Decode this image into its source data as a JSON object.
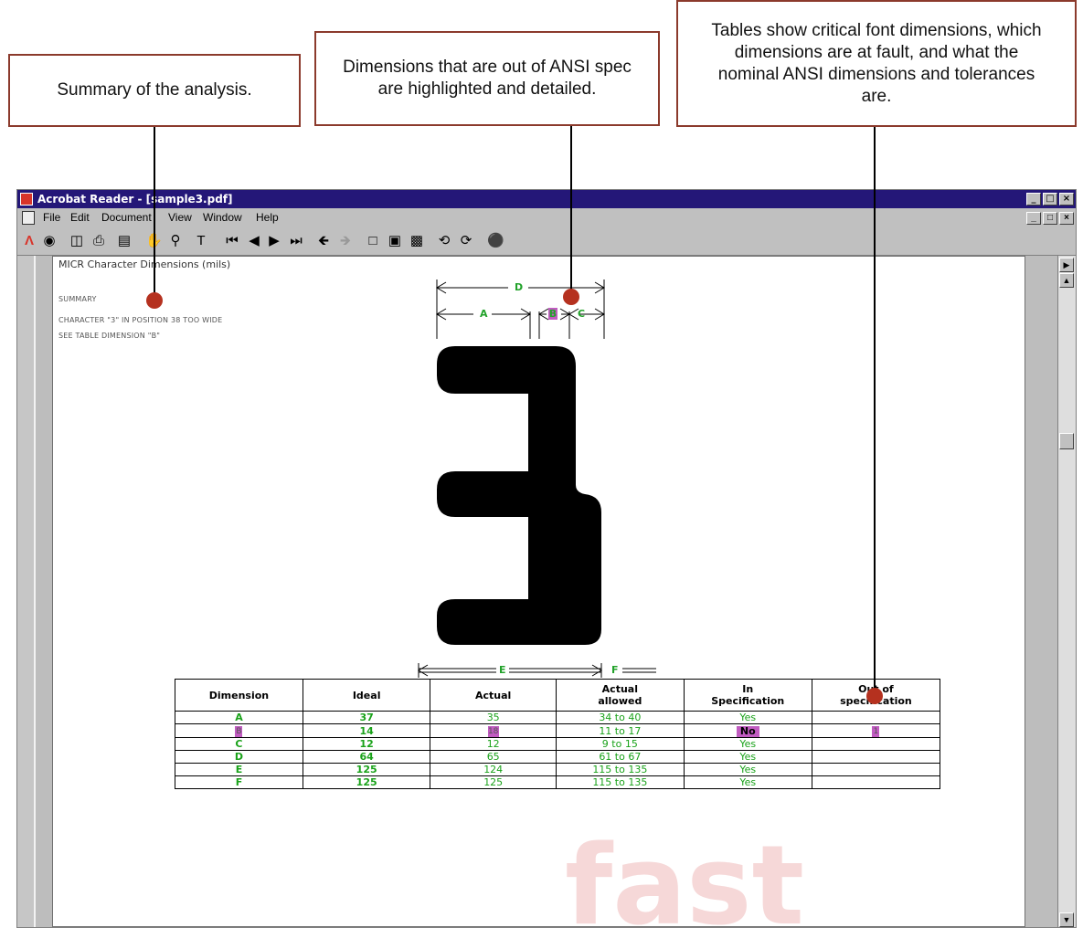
{
  "callouts": {
    "summary": "Summary of the analysis.",
    "dimensions": "Dimensions that are out of ANSI spec are highlighted and detailed.",
    "tables": "Tables show critical font dimensions, which dimensions are at fault, and what the nominal ANSI dimensions and tolerances are."
  },
  "window": {
    "title": "Acrobat Reader - [sample3.pdf]",
    "controls": [
      "_",
      "ɑ",
      "×"
    ]
  },
  "menu": {
    "items": [
      "File",
      "Edit",
      "Document",
      "View",
      "Window",
      "Help"
    ]
  },
  "toolbar": {
    "buttons": [
      "acrobat-logo-icon",
      "web-icon",
      "open-icon",
      "print-icon",
      "thumbnails-icon",
      "hand-tool-icon",
      "zoom-tool-icon",
      "text-select-icon",
      "first-page-icon",
      "previous-page-icon",
      "next-page-icon",
      "last-page-icon",
      "go-back-icon",
      "go-forward-icon",
      "actual-size-icon",
      "fit-page-icon",
      "fit-width-icon",
      "rotate-left-icon",
      "rotate-right-icon",
      "find-icon"
    ]
  },
  "page": {
    "heading": "MICR Character Dimensions (mils)",
    "summary_label": "SUMMARY",
    "summary_line1": "CHARACTER \"3\" IN POSITION 38 TOO WIDE",
    "summary_line2": "SEE TABLE DIMENSION \"B\"",
    "dim_labels": {
      "D": "D",
      "A": "A",
      "B": "B",
      "C": "C",
      "E": "E",
      "F": "F"
    },
    "watermark": "fast"
  },
  "table": {
    "headers": [
      "Dimension",
      "Ideal",
      "Actual",
      "Actual allowed",
      "In Specification",
      "Out of specification"
    ],
    "header_lines": [
      [
        "Dimension"
      ],
      [
        "Ideal"
      ],
      [
        "Actual"
      ],
      [
        "Actual",
        "allowed"
      ],
      [
        "In",
        "Specification"
      ],
      [
        "Out of",
        "specification"
      ]
    ],
    "rows": [
      {
        "dimension": "A",
        "ideal": "37",
        "actual": "35",
        "allowed": "34 to 40",
        "in_spec": "Yes",
        "out_spec": "",
        "highlight": false
      },
      {
        "dimension": "B",
        "ideal": "14",
        "actual": "18",
        "allowed": "11 to 17",
        "in_spec": "No",
        "out_spec": "1",
        "highlight": true
      },
      {
        "dimension": "C",
        "ideal": "12",
        "actual": "12",
        "allowed": "9 to 15",
        "in_spec": "Yes",
        "out_spec": "",
        "highlight": false
      },
      {
        "dimension": "D",
        "ideal": "64",
        "actual": "65",
        "allowed": "61 to 67",
        "in_spec": "Yes",
        "out_spec": "",
        "highlight": false
      },
      {
        "dimension": "E",
        "ideal": "125",
        "actual": "124",
        "allowed": "115 to 135",
        "in_spec": "Yes",
        "out_spec": "",
        "highlight": false
      },
      {
        "dimension": "F",
        "ideal": "125",
        "actual": "125",
        "allowed": "115 to 135",
        "in_spec": "Yes",
        "out_spec": "",
        "highlight": false
      }
    ]
  },
  "colors": {
    "title_bar": "#241778",
    "callout_border": "#8b3a2c",
    "dot": "#b5311f",
    "dimension_green": "#1aa21a",
    "highlight": "#c15cc1"
  }
}
